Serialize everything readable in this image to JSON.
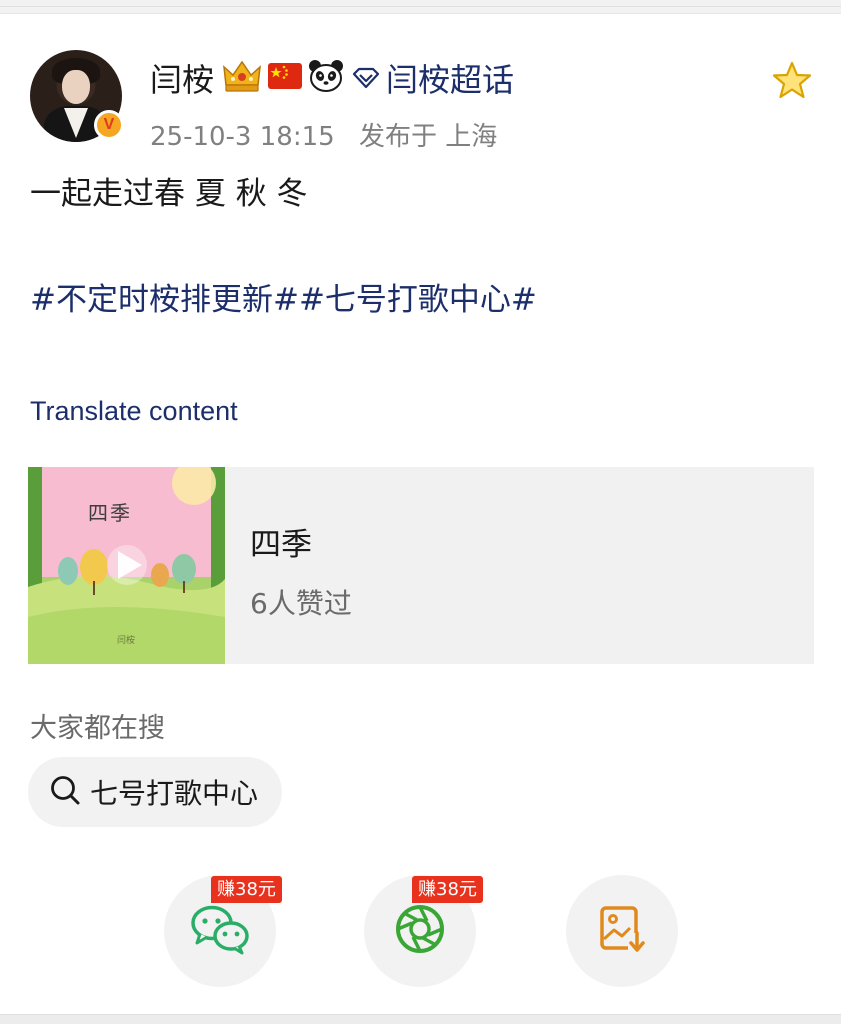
{
  "colors": {
    "link": "#1d2f6b",
    "earn_badge": "#e8321e",
    "wechat_green": "#2aae67",
    "moments_green": "#3aa635",
    "save_orange": "#e08a1e",
    "star_gold": "#f5b800"
  },
  "header": {
    "username": "闫桉",
    "badges": [
      "crown-icon",
      "china-flag-icon",
      "panda-icon"
    ],
    "supertopic_label": "闫桉超话",
    "timestamp": "25-10-3 18:15",
    "location": "发布于 上海",
    "verified_mark": "V"
  },
  "post": {
    "text": "一起走过春 夏 秋 冬",
    "hashtags": "#不定时桉排更新##七号打歌中心#",
    "translate_label": "Translate content"
  },
  "music": {
    "cover_title": "四季",
    "title": "四季",
    "likes": "6人赞过"
  },
  "search": {
    "heading": "大家都在搜",
    "chip_label": "七号打歌中心"
  },
  "share": {
    "wechat_earn": "赚38元",
    "moments_earn": "赚38元",
    "icons": [
      "wechat-icon",
      "moments-icon",
      "save-image-icon"
    ]
  }
}
